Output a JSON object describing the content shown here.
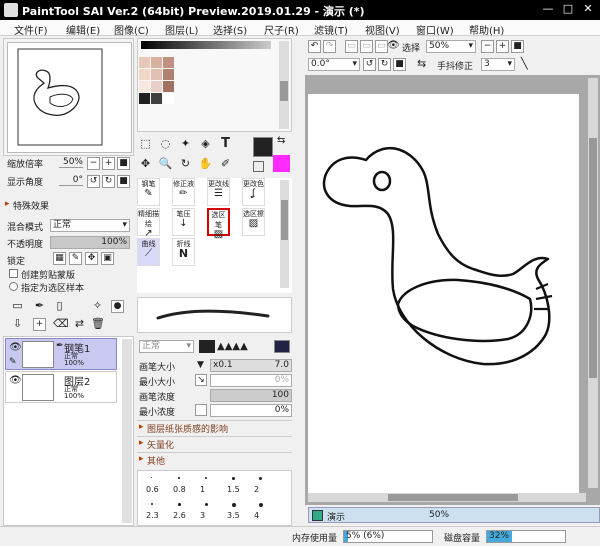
{
  "window": {
    "title": "PaintTool SAI Ver.2 (64bit) Preview.2019.01.29 - 演示 (*)",
    "minimize": "—",
    "maximize": "□",
    "close": "✕"
  },
  "menu": [
    "文件(F)",
    "编辑(E)",
    "图像(C)",
    "图层(L)",
    "选择(S)",
    "尺子(R)",
    "滤镜(T)",
    "视图(V)",
    "窗口(W)",
    "帮助(H)"
  ],
  "navigator": {
    "zoom_label": "缩放倍率",
    "zoom_value": "50%",
    "angle_label": "显示角度",
    "angle_value": "0°"
  },
  "effects": {
    "header": "特殊效果"
  },
  "layer_props": {
    "blend_label": "混合模式",
    "blend_value": "正常",
    "opacity_label": "不透明度",
    "opacity_value": "100%",
    "lock_label": "锁定",
    "clip_label": "创建剪贴蒙版",
    "ref_label": "指定为选区样本"
  },
  "layers": [
    {
      "name": "钢笔1",
      "mode": "正常",
      "opacity": "100%"
    },
    {
      "name": "图层2",
      "mode": "正常",
      "opacity": "100%"
    }
  ],
  "tools": {
    "text_tool": "T"
  },
  "brushes": [
    [
      "钢笔",
      "修正液",
      "更改线",
      "更改色"
    ],
    [
      "精细描绘",
      "笔压",
      "选区笔",
      "选区擦"
    ],
    [
      "曲线",
      "折线",
      "",
      ""
    ]
  ],
  "brush_settings": {
    "mode": "正常",
    "size_label": "画笔大小",
    "size_mult": "x0.1",
    "size_value": "7.0",
    "min_size_label": "最小大小",
    "min_size_value": "0%",
    "density_label": "画笔浓度",
    "density_value": "100",
    "min_density_label": "最小浓度",
    "min_density_value": "0%",
    "paper_label": "图层纸张质感的影响",
    "vector_label": "矢量化",
    "other_label": "其他"
  },
  "size_grid": [
    [
      "0.6",
      "0.8",
      "1",
      "1.5",
      "2"
    ],
    [
      "2.3",
      "2.6",
      "3",
      "3.5",
      "4"
    ]
  ],
  "canvas_toolbar": {
    "select_label": "选择",
    "zoom_value": "50%",
    "angle_value": "0.0°",
    "stabilizer_label": "手抖修正",
    "stabilizer_value": "3"
  },
  "doc_tab": {
    "name": "演示",
    "zoom": "50%"
  },
  "statusbar": {
    "mem_label": "内存使用量",
    "mem_value": "5% (6%)",
    "mem_fraction": 0.05,
    "disk_label": "磁盘容量",
    "disk_value": "32%",
    "disk_fraction": 0.32
  },
  "colors": {
    "primary": "#222222",
    "secondary": "#ff2aff",
    "highlight": "#d40000",
    "swatches": [
      "#e8c8b8",
      "#d8b0a0",
      "#c09080",
      "#f0d8c8",
      "#e0c0b0",
      "#b08070",
      "#f8e8e0",
      "#e8d0c8",
      "#a07060",
      "#202020",
      "#404040",
      "#ffffff"
    ]
  }
}
